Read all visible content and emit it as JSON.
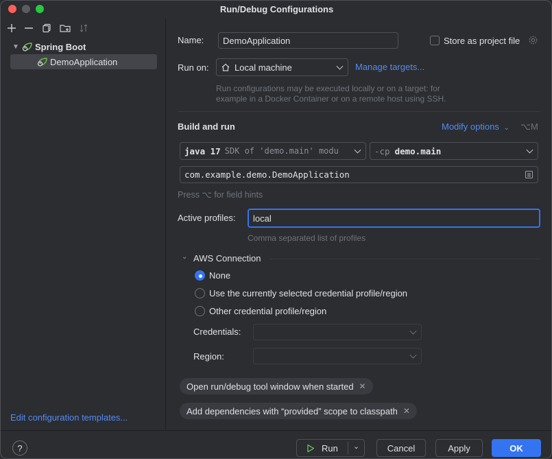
{
  "window": {
    "title": "Run/Debug Configurations"
  },
  "colors": {
    "accent": "#3574f0",
    "link": "#548af7",
    "spring": "#6cbf43",
    "run": "#5fb865"
  },
  "toolbar": {
    "icons": [
      "plus-icon",
      "minus-icon",
      "copy-icon",
      "folder-icon",
      "sort-icon"
    ]
  },
  "tree": {
    "group": "Spring Boot",
    "items": [
      {
        "label": "DemoApplication",
        "selected": true
      }
    ]
  },
  "left_footer": {
    "edit_templates": "Edit configuration templates..."
  },
  "form": {
    "name_label": "Name:",
    "name_value": "DemoApplication",
    "store_label": "Store as project file",
    "store_checked": false,
    "run_on_label": "Run on:",
    "run_on_value": "Local machine",
    "manage_targets": "Manage targets...",
    "run_on_hint_1": "Run configurations may be executed locally or on a target: for",
    "run_on_hint_2": "example in a Docker Container or on a remote host using SSH."
  },
  "build": {
    "title": "Build and run",
    "modify_options": "Modify options",
    "modify_shortcut": "⌥M",
    "sdk_bold": "java 17",
    "sdk_detail": "SDK of 'demo.main' modu",
    "cp_prefix": "-cp",
    "cp_value": "demo.main",
    "main_class": "com.example.demo.DemoApplication",
    "field_hint": "Press ⌥ for field hints"
  },
  "profiles": {
    "label": "Active profiles:",
    "value": "local",
    "hint": "Comma separated list of profiles"
  },
  "aws": {
    "title": "AWS Connection",
    "options": [
      {
        "label": "None",
        "selected": true
      },
      {
        "label": "Use the currently selected credential profile/region",
        "selected": false
      },
      {
        "label": "Other credential profile/region",
        "selected": false
      }
    ],
    "credentials_label": "Credentials:",
    "credentials_value": "",
    "region_label": "Region:",
    "region_value": ""
  },
  "chips": [
    {
      "label": "Open run/debug tool window when started"
    },
    {
      "label": "Add dependencies with “provided” scope to classpath"
    }
  ],
  "footer": {
    "help": "?",
    "run": "Run",
    "cancel": "Cancel",
    "apply": "Apply",
    "ok": "OK"
  }
}
